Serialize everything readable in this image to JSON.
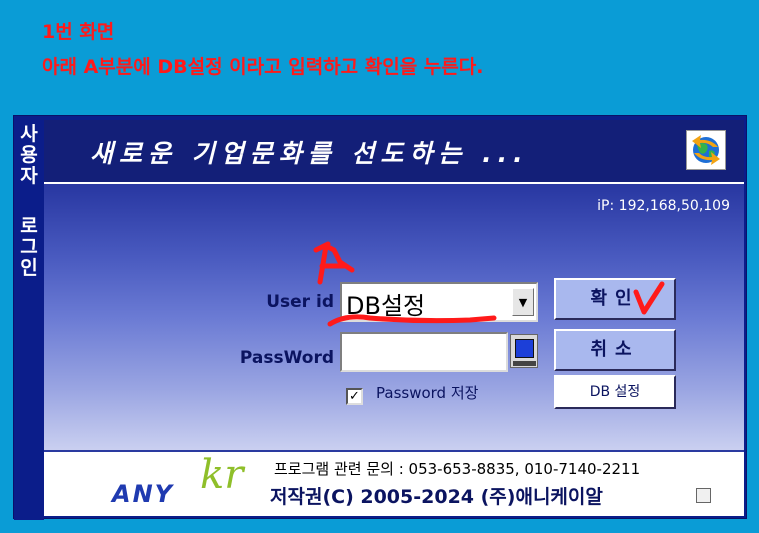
{
  "instructions": {
    "line1": "1번 화면",
    "line2": "아래 A부분에 DB설정 이라고 입력하고 확인을 누른다."
  },
  "sidebar": {
    "title_text": "사용자",
    "subtitle_text": "로그인"
  },
  "header": {
    "slogan": "새로운 기업문화를 선도하는 ...",
    "icon": "globe-arrows-icon"
  },
  "ip_text": "iP: 192,168,50,109",
  "form": {
    "userid_label": "User id",
    "userid_value": "DB설정",
    "password_label": "PassWord",
    "password_value": "",
    "save_password_checked": true,
    "save_password_label": "Password 저장"
  },
  "buttons": {
    "confirm": "확인",
    "cancel": "취소",
    "db_settings": "DB 설정"
  },
  "annotations": {
    "marker_a": "A",
    "marker_check": "V",
    "color": "#ff1a1a"
  },
  "footer": {
    "logo_primary": "ANY",
    "logo_accent": "kr",
    "contact": "프로그램 관련 문의 : 053-653-8835, 010-7140-2211",
    "copyright": "저작권(C) 2005-2024 (주)애니케이알"
  },
  "colors": {
    "background": "#0a9cd6",
    "window_navy": "#0b1d8a",
    "button_lavender": "#a9b8ee",
    "annotation_red": "#ff1a1a"
  }
}
